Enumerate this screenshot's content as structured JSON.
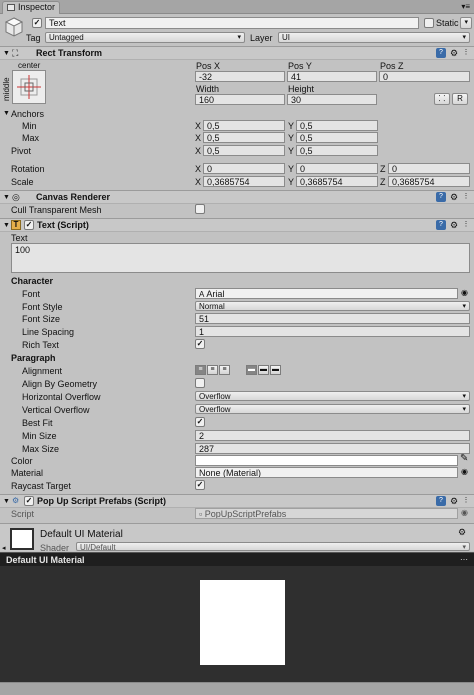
{
  "tab": {
    "label": "Inspector"
  },
  "go": {
    "name": "Text",
    "static_label": "Static",
    "tag_label": "Tag",
    "tag_value": "Untagged",
    "layer_label": "Layer",
    "layer_value": "UI"
  },
  "rect": {
    "title": "Rect Transform",
    "anchor_top": "center",
    "anchor_side": "middle",
    "pos_x_label": "Pos X",
    "pos_x": "-32",
    "pos_y_label": "Pos Y",
    "pos_y": "41",
    "pos_z_label": "Pos Z",
    "pos_z": "0",
    "width_label": "Width",
    "width": "160",
    "height_label": "Height",
    "height": "30",
    "r_button": "R",
    "anchors_label": "Anchors",
    "min_label": "Min",
    "min_x": "0,5",
    "min_y": "0,5",
    "max_label": "Max",
    "max_x": "0,5",
    "max_y": "0,5",
    "pivot_label": "Pivot",
    "pivot_x": "0,5",
    "pivot_y": "0,5",
    "rotation_label": "Rotation",
    "rot_x": "0",
    "rot_y": "0",
    "rot_z": "0",
    "scale_label": "Scale",
    "scale_x": "0,3685754",
    "scale_y": "0,3685754",
    "scale_z": "0,3685754",
    "x": "X",
    "y": "Y",
    "z": "Z"
  },
  "canvas": {
    "title": "Canvas Renderer",
    "cull_label": "Cull Transparent Mesh"
  },
  "text": {
    "title": "Text (Script)",
    "text_label": "Text",
    "text_value": "100",
    "character_label": "Character",
    "font_label": "Font",
    "font_value": "Arial",
    "font_style_label": "Font Style",
    "font_style_value": "Normal",
    "font_size_label": "Font Size",
    "font_size_value": "51",
    "line_spacing_label": "Line Spacing",
    "line_spacing_value": "1",
    "rich_text_label": "Rich Text",
    "paragraph_label": "Paragraph",
    "alignment_label": "Alignment",
    "align_by_geometry_label": "Align By Geometry",
    "horizontal_overflow_label": "Horizontal Overflow",
    "horizontal_overflow_value": "Overflow",
    "vertical_overflow_label": "Vertical Overflow",
    "vertical_overflow_value": "Overflow",
    "best_fit_label": "Best Fit",
    "min_size_label": "Min Size",
    "min_size_value": "2",
    "max_size_label": "Max Size",
    "max_size_value": "287",
    "color_label": "Color",
    "material_label": "Material",
    "material_value": "None (Material)",
    "raycast_label": "Raycast Target"
  },
  "popup": {
    "title": "Pop Up Script Prefabs (Script)",
    "script_label": "Script",
    "script_value": "PopUpScriptPrefabs"
  },
  "material": {
    "name": "Default UI Material",
    "shader_label": "Shader",
    "shader_value": "UI/Default"
  },
  "preview": {
    "title": "Default UI Material"
  },
  "colors": {
    "panel": "#c2c2c2",
    "preview_bg": "#2f2f2f",
    "accent_blue": "#3a6ba8"
  }
}
